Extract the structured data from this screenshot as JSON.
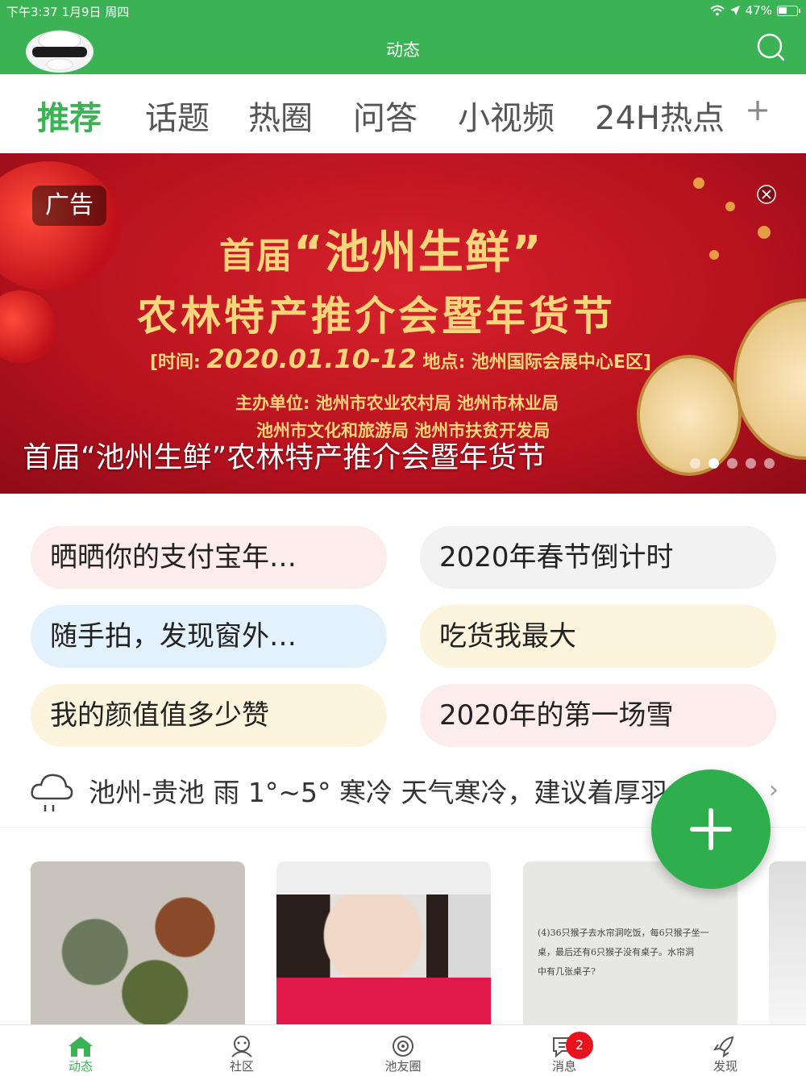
{
  "status_bar": {
    "time_date": "下午3:37   1月9日 周四",
    "battery": "47%"
  },
  "header": {
    "title": "动态"
  },
  "tabs": [
    {
      "label": "推荐",
      "active": true
    },
    {
      "label": "话题",
      "active": false
    },
    {
      "label": "热圈",
      "active": false
    },
    {
      "label": "问答",
      "active": false
    },
    {
      "label": "小视频",
      "active": false
    },
    {
      "label": "24H热点",
      "active": false
    }
  ],
  "tabs_add": "+",
  "banner": {
    "ad_badge": "广告",
    "title_prefix": "首届",
    "title_quote": "“池州生鲜”",
    "subtitle": "农林特产推介会暨年货节",
    "time_label": "[时间:",
    "time_value": "2020.01.10-12",
    "place": "地点: 池州国际会展中心E区]",
    "organizers_1": "主办单位: 池州市农业农村局  池州市林业局",
    "organizers_2": "池州市文化和旅游局  池州市扶贫开发局",
    "caption": "首届“池州生鲜”农林特产推介会暨年货节",
    "slide_count": 5,
    "active_slide": 2
  },
  "topics": [
    {
      "label": "晒晒你的支付宝年…",
      "color": "#fcecec"
    },
    {
      "label": "2020年春节倒计时",
      "color": "#f2f2f2"
    },
    {
      "label": "随手拍，发现窗外…",
      "color": "#e2f1fb"
    },
    {
      "label": "吃货我最大",
      "color": "#fcf4dc"
    },
    {
      "label": "我的颜值值多少赞",
      "color": "#fcf4dc"
    },
    {
      "label": "2020年的第一场雪",
      "color": "#fcecec"
    }
  ],
  "weather": {
    "text": "池州-贵池 雨 1°~5° 寒冷 天气寒冷，建议着厚羽",
    "icon": "rain-cloud-icon"
  },
  "thumbnails": [
    {
      "icon": "food-photo"
    },
    {
      "icon": "portrait-photo"
    },
    {
      "icon": "textbook-photo"
    },
    {
      "icon": "partial-photo"
    }
  ],
  "homework_text": {
    "line1": "(4)36只猴子去水帘洞吃饭，每6只猴子坐一",
    "line2": "桌，最后还有6只猴子没有桌子。水帘洞",
    "line3": "中有几张桌子?"
  },
  "tabbar": [
    {
      "label": "动态",
      "icon": "home-icon",
      "active": true
    },
    {
      "label": "社区",
      "icon": "community-icon",
      "active": false
    },
    {
      "label": "池友圈",
      "icon": "circle-icon",
      "active": false
    },
    {
      "label": "消息",
      "icon": "message-icon",
      "active": false,
      "badge": "2"
    },
    {
      "label": "发现",
      "icon": "discover-icon",
      "active": false
    }
  ],
  "colors": {
    "brand_green": "#3bb354",
    "banner_red": "#c0141f",
    "banner_gold": "#f7d57a",
    "badge_red": "#e8131d"
  }
}
